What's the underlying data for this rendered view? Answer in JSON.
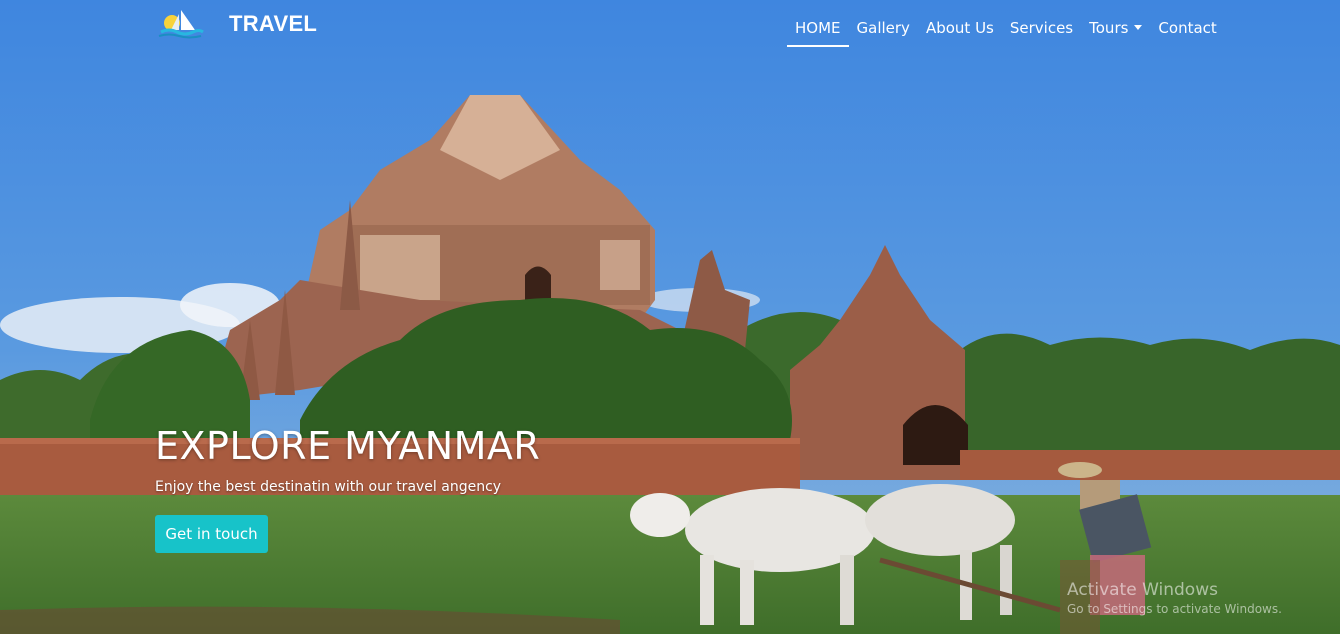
{
  "brand": {
    "name": "TRAVEL",
    "logo_icon": "sailboat-sun-icon"
  },
  "nav": {
    "items": [
      {
        "label": "HOME",
        "active": true
      },
      {
        "label": "Gallery"
      },
      {
        "label": "About Us"
      },
      {
        "label": "Services"
      },
      {
        "label": "Tours",
        "dropdown": true
      },
      {
        "label": "Contact"
      }
    ]
  },
  "hero": {
    "title": "EXPLORE MYANMAR",
    "subtitle": "Enjoy the best destinatin with our travel angency",
    "cta_label": "Get in touch",
    "background": "bagan-temple-photo"
  },
  "watermark": {
    "title": "Activate Windows",
    "subtitle": "Go to Settings to activate Windows."
  },
  "colors": {
    "accent": "#17c3c9",
    "sky": "#4a8ad8",
    "text": "#ffffff"
  }
}
